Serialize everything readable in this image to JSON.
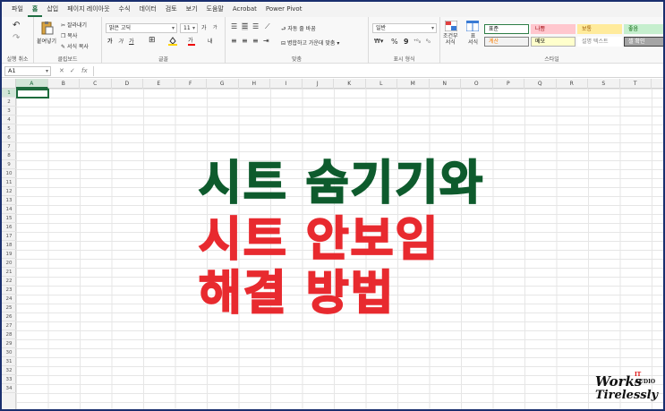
{
  "tabs": [
    "파일",
    "홈",
    "삽입",
    "페이지 레이아웃",
    "수식",
    "데이터",
    "검토",
    "보기",
    "도움말",
    "Acrobat",
    "Power Pivot"
  ],
  "active_tab_index": 1,
  "ribbon": {
    "undo_label": "실행 취소",
    "clipboard": {
      "paste": "붙여넣기",
      "cut": "잘라내기",
      "copy": "복사",
      "format_painter": "서식 복사",
      "label": "클립보드"
    },
    "font": {
      "name": "맑은 고딕",
      "size": "11",
      "grow": "가",
      "shrink": "가",
      "bold": "가",
      "italic": "가",
      "underline": "가",
      "color_label": "가",
      "phonetic": "내",
      "label": "글꼴"
    },
    "alignment": {
      "wrap": "자동 줄 바꿈",
      "merge": "병합하고 가운데 맞춤",
      "label": "맞춤"
    },
    "number": {
      "format": "일반",
      "percent": "%",
      "comma": "9",
      "label": "표시 형식"
    },
    "styles": {
      "conditional": "조건부\n서식",
      "table": "표\n서식",
      "cells": [
        {
          "label": "표준",
          "bg": "#ffffff",
          "fg": "#000000",
          "border": "#2e7d46"
        },
        {
          "label": "나쁨",
          "bg": "#ffc7ce",
          "fg": "#9c0006",
          "border": "#ffc7ce"
        },
        {
          "label": "보통",
          "bg": "#ffeb9c",
          "fg": "#9c5700",
          "border": "#ffeb9c"
        },
        {
          "label": "좋음",
          "bg": "#c6efce",
          "fg": "#006100",
          "border": "#c6efce"
        },
        {
          "label": "계산",
          "bg": "#f2f2f2",
          "fg": "#fa7d00",
          "border": "#7f7f7f"
        },
        {
          "label": "메모",
          "bg": "#ffffcc",
          "fg": "#000000",
          "border": "#b2b2b2"
        },
        {
          "label": "설명 텍스트",
          "bg": "#ffffff",
          "fg": "#7f7f7f",
          "border": "#ffffff"
        },
        {
          "label": "셀 확인",
          "bg": "#a5a5a5",
          "fg": "#ffffff",
          "border": "#3f3f3f"
        }
      ],
      "label": "스타일"
    }
  },
  "formula_bar": {
    "name_box": "A1",
    "fx": "fx",
    "content": ""
  },
  "columns": [
    "A",
    "B",
    "C",
    "D",
    "E",
    "F",
    "G",
    "H",
    "I",
    "J",
    "K",
    "L",
    "M",
    "N",
    "O",
    "P",
    "Q",
    "R",
    "S",
    "T"
  ],
  "rows": [
    "1",
    "2",
    "3",
    "4",
    "5",
    "6",
    "7",
    "8",
    "9",
    "10",
    "11",
    "12",
    "13",
    "14",
    "15",
    "16",
    "17",
    "18",
    "19",
    "20",
    "21",
    "22",
    "23",
    "24",
    "25",
    "26",
    "27",
    "28",
    "29",
    "30",
    "31",
    "32",
    "33",
    "34"
  ],
  "selected_cell": "A1",
  "overlay": {
    "line1": "시트 숨기기와",
    "line2": "시트 안보임",
    "line3": "해결 방법",
    "color1": "#0e5b2d",
    "color2": "#e82a2f"
  },
  "watermark": {
    "it": "IT",
    "audio": "AUDIO",
    "works": "Works",
    "tirelessly": "Tirelessly"
  }
}
